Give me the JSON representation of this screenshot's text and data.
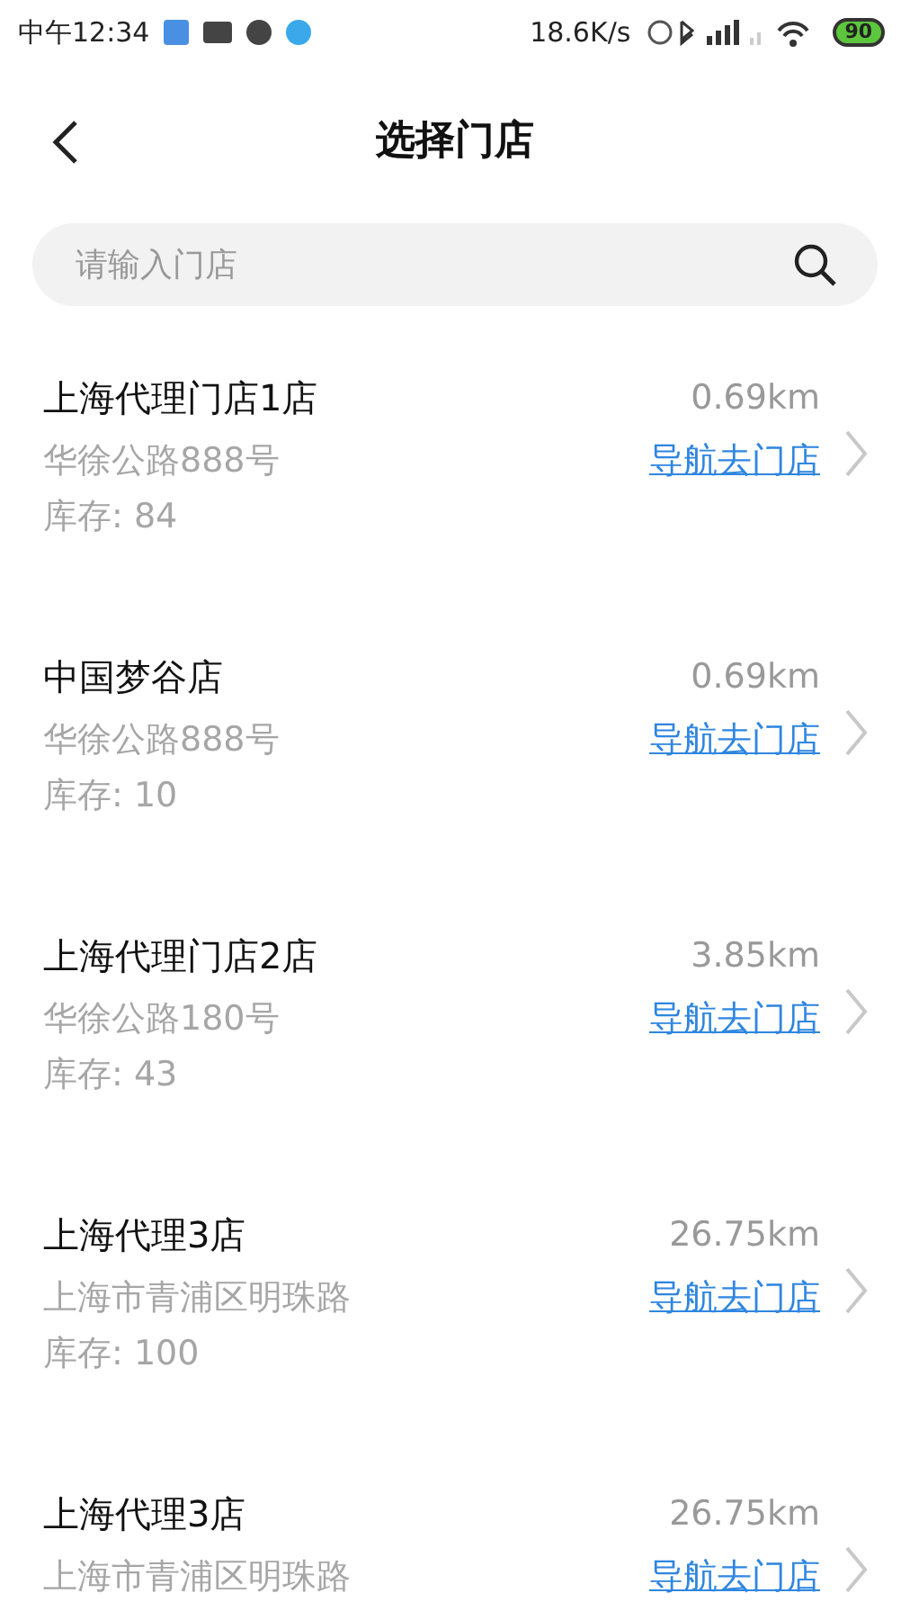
{
  "status_bar": {
    "time": "中午12:34",
    "speed": "18.6K/s",
    "battery": "90"
  },
  "header": {
    "title": "选择门店"
  },
  "search": {
    "placeholder": "请输入门店"
  },
  "stores": [
    {
      "name": "上海代理门店1店",
      "distance": "0.69km",
      "address": "华徐公路888号",
      "link": "导航去门店",
      "stock": "库存: 84"
    },
    {
      "name": "中国梦谷店",
      "distance": "0.69km",
      "address": "华徐公路888号",
      "link": "导航去门店",
      "stock": "库存: 10"
    },
    {
      "name": "上海代理门店2店",
      "distance": "3.85km",
      "address": "华徐公路180号",
      "link": "导航去门店",
      "stock": "库存: 43"
    },
    {
      "name": "上海代理3店",
      "distance": "26.75km",
      "address": "上海市青浦区明珠路",
      "link": "导航去门店",
      "stock": "库存: 100"
    },
    {
      "name": "上海代理3店",
      "distance": "26.75km",
      "address": "上海市青浦区明珠路",
      "link": "导航去门店"
    }
  ]
}
